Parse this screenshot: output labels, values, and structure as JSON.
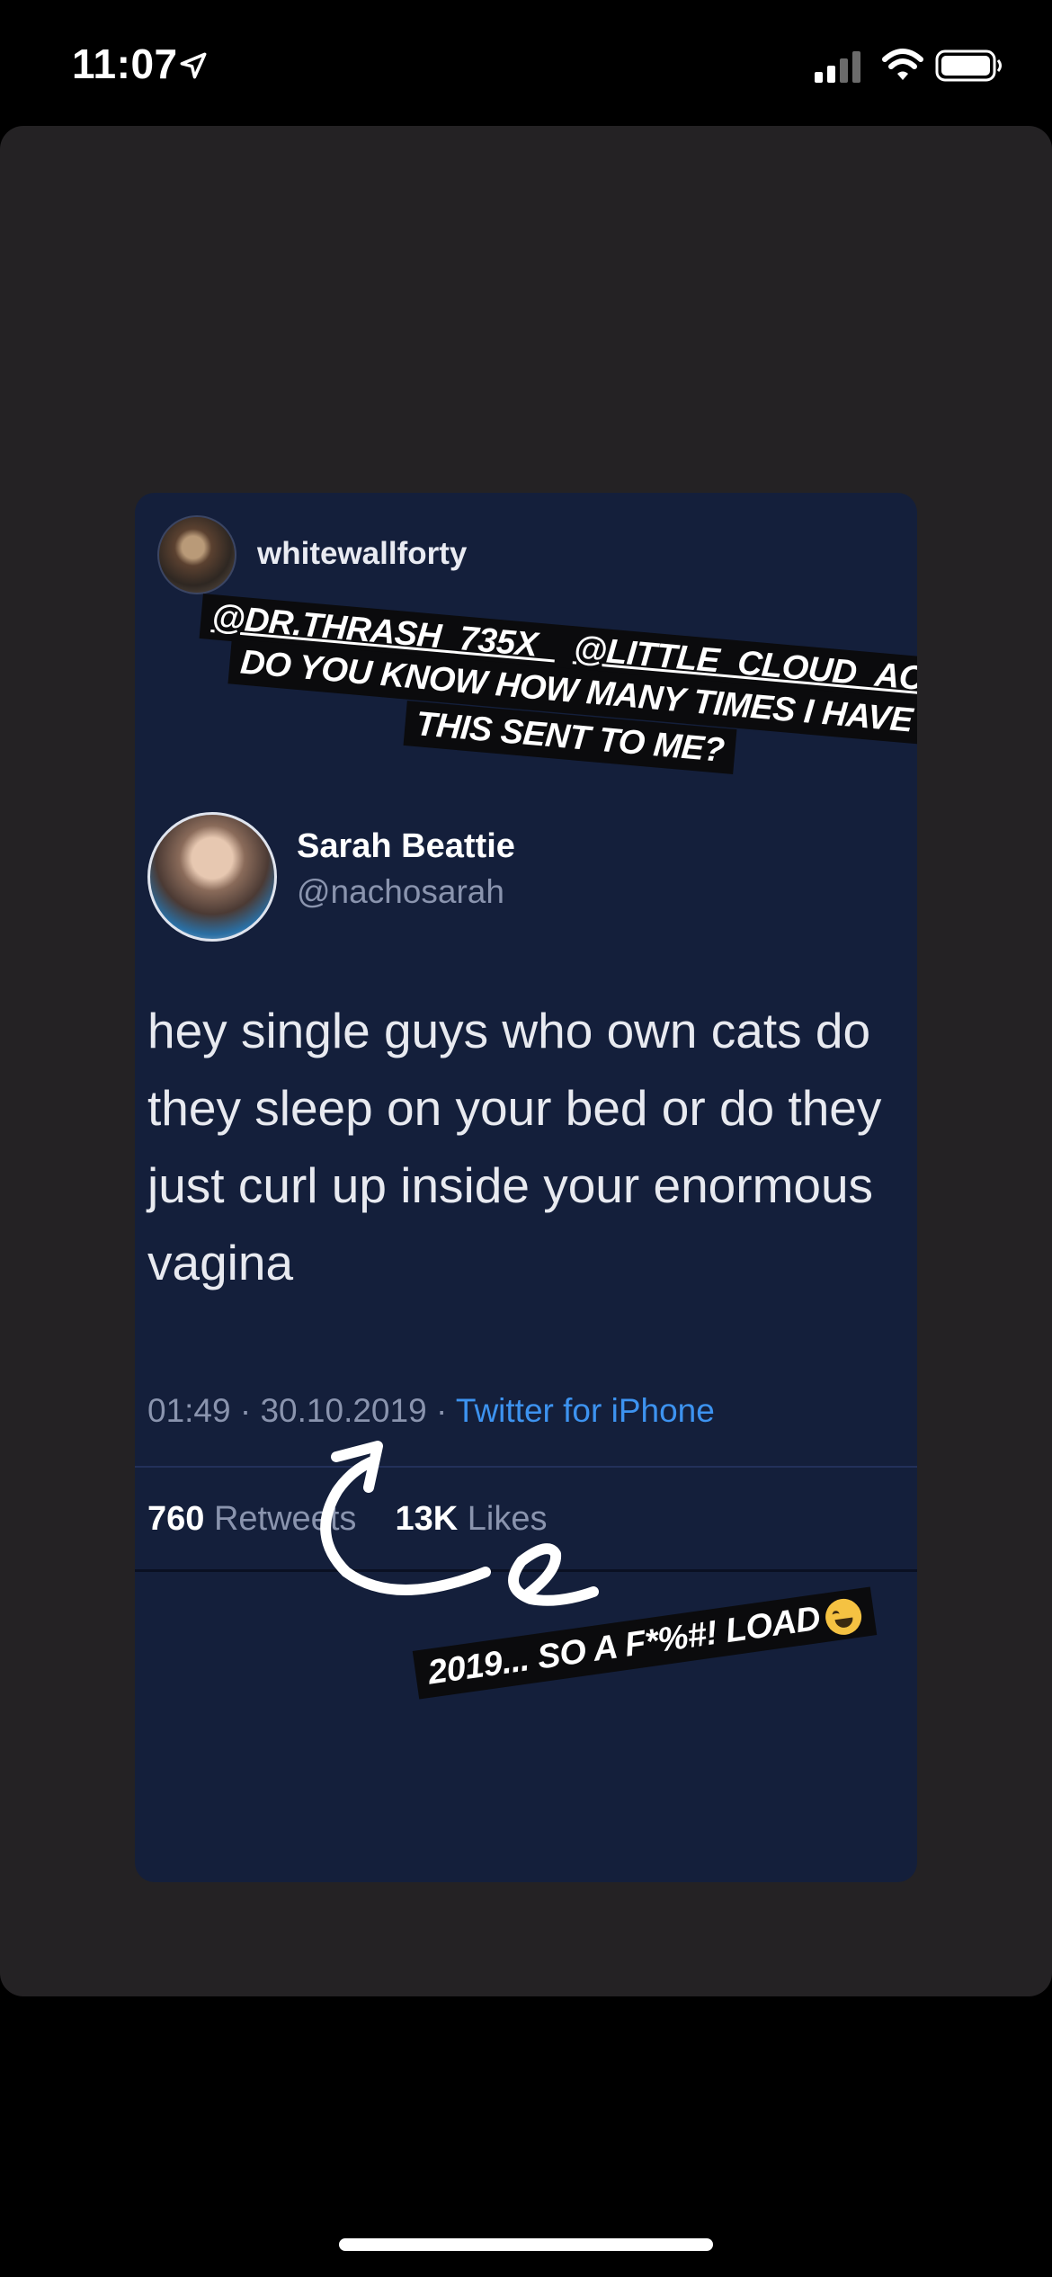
{
  "status_bar": {
    "time": "11:07",
    "icons": [
      "location-arrow-icon",
      "cellular-signal-icon",
      "wifi-icon",
      "battery-icon"
    ]
  },
  "story": {
    "username": "whitewallforty",
    "caption_lines": [
      {
        "mention1": "@DR.THRASH_735X_",
        "mention2": "@LITTLE_CLOUD_ACTUAL"
      },
      "DO YOU KNOW HOW MANY TIMES I HAVE HAD",
      "THIS SENT TO ME?"
    ],
    "bottom_caption": "2019... SO A F*%#! LOAD",
    "bottom_emoji": "face-with-tears-of-joy-icon"
  },
  "tweet": {
    "display_name": "Sarah Beattie",
    "handle": "@nachosarah",
    "text": "hey single guys who own cats do they sleep on your bed or do they just curl up inside your enormous vagina",
    "time": "01:49",
    "date": "30.10.2019",
    "source": "Twitter for iPhone",
    "separator": "·",
    "retweets_count": "760",
    "retweets_label": "Retweets",
    "likes_count": "13K",
    "likes_label": "Likes"
  },
  "colors": {
    "background": "#000000",
    "sheet": "#242224",
    "tweet_card": "#141f3b",
    "link_blue": "#3d93f0",
    "muted_text": "#8a94ae"
  }
}
